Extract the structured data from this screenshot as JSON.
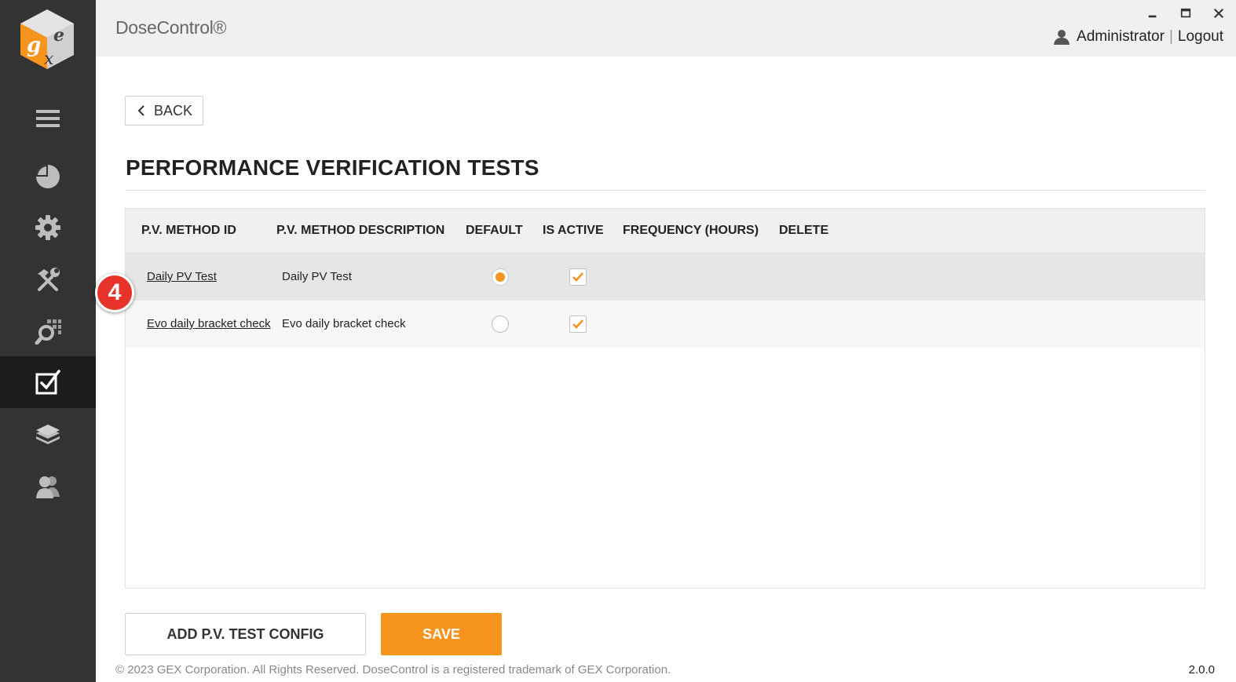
{
  "app": {
    "title": "DoseControl®"
  },
  "header": {
    "user_name": "Administrator",
    "separator": "|",
    "logout_label": "Logout"
  },
  "sidebar": {
    "items": [
      {
        "icon": "hamburger-menu-icon"
      },
      {
        "icon": "pie-chart-icon"
      },
      {
        "icon": "gear-icon"
      },
      {
        "icon": "tools-icon"
      },
      {
        "icon": "search-grid-icon"
      },
      {
        "icon": "checkbox-icon",
        "active": true
      },
      {
        "icon": "layers-icon"
      },
      {
        "icon": "users-icon"
      }
    ]
  },
  "main": {
    "back_label": "BACK",
    "page_title": "PERFORMANCE VERIFICATION TESTS",
    "table": {
      "columns": [
        "P.V. METHOD ID",
        "P.V. METHOD DESCRIPTION",
        "DEFAULT",
        "IS ACTIVE",
        "FREQUENCY (HOURS)",
        "DELETE"
      ],
      "rows": [
        {
          "method_id": "Daily PV Test",
          "description": "Daily PV Test",
          "default": true,
          "is_active": true,
          "frequency": "",
          "delete": ""
        },
        {
          "method_id": "Evo daily bracket check",
          "description": "Evo daily bracket check",
          "default": false,
          "is_active": true,
          "frequency": "",
          "delete": ""
        }
      ]
    },
    "step_badge": "4",
    "add_button_label": "ADD P.V. TEST CONFIG",
    "save_button_label": "SAVE"
  },
  "footer": {
    "copyright": "© 2023 GEX Corporation. All Rights Reserved. DoseControl is a registered trademark of GEX Corporation.",
    "version": "2.0.0"
  },
  "colors": {
    "accent": "#f7941d",
    "sidebar": "#333333",
    "sidebar_active": "#1c1c1c",
    "badge": "#e8332a"
  }
}
